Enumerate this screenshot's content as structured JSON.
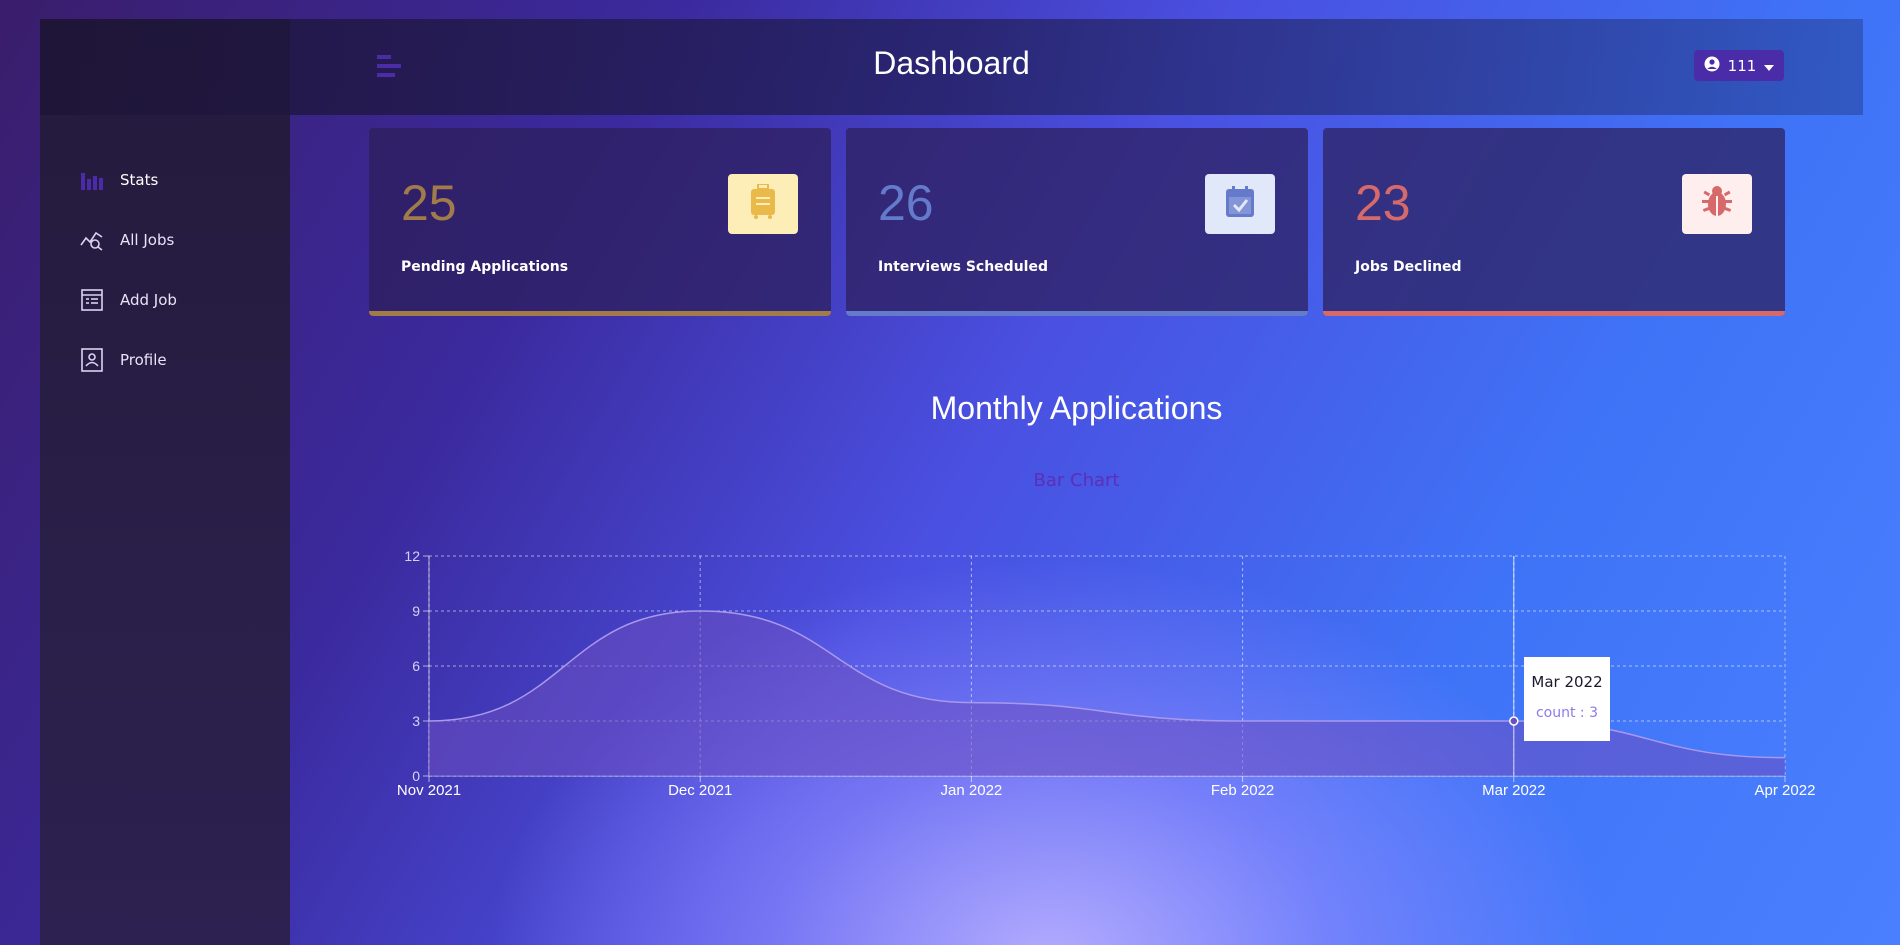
{
  "sidebar": {
    "items": [
      {
        "label": "Stats",
        "icon": "bar-chart-icon"
      },
      {
        "label": "All Jobs",
        "icon": "chart-search-icon"
      },
      {
        "label": "Add Job",
        "icon": "form-icon"
      },
      {
        "label": "Profile",
        "icon": "id-card-icon"
      }
    ]
  },
  "navbar": {
    "title": "Dashboard",
    "user": "111"
  },
  "stats": [
    {
      "count": "25",
      "label": "Pending Applications",
      "color": "#a17b4a",
      "icon_bg": "#fdeeb8",
      "icon_color": "#e9b949",
      "icon": "suitcase-icon"
    },
    {
      "count": "26",
      "label": "Interviews Scheduled",
      "color": "#647acb",
      "icon_bg": "#e0e8f9",
      "icon_color": "#647acb",
      "icon": "calendar-check-icon"
    },
    {
      "count": "23",
      "label": "Jobs Declined",
      "color": "#d66a6a",
      "icon_bg": "#ffeeee",
      "icon_color": "#d66a6a",
      "icon": "bug-icon"
    }
  ],
  "chart_section": {
    "title": "Monthly Applications",
    "toggle": "Bar Chart"
  },
  "tooltip": {
    "title": "Mar 2022",
    "value": "count : 3"
  },
  "chart_data": {
    "type": "area",
    "categories": [
      "Nov 2021",
      "Dec 2021",
      "Jan 2022",
      "Feb 2022",
      "Mar 2022",
      "Apr 2022"
    ],
    "series": [
      {
        "name": "count",
        "values": [
          3,
          9,
          4,
          3,
          3,
          1
        ]
      }
    ],
    "yticks": [
      0,
      3,
      6,
      9,
      12
    ],
    "ylim": [
      0,
      12
    ],
    "grid": true,
    "fill_color": "#6b4fbf",
    "line_color": "#a999ee"
  }
}
